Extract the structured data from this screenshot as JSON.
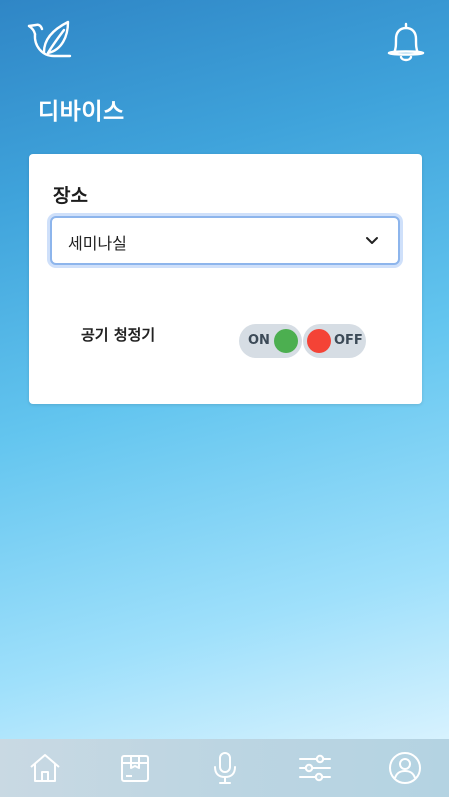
{
  "header": {
    "logo_icon": "dove-leaf-logo-icon",
    "notification_icon": "bell-icon"
  },
  "page": {
    "title": "디바이스"
  },
  "location": {
    "label": "장소",
    "selected": "세미나실"
  },
  "device": {
    "name": "공기 청정기",
    "on_label": "ON",
    "off_label": "OFF",
    "on_color": "#4caf50",
    "off_color": "#f44336"
  },
  "bottom_nav": [
    {
      "icon": "home-icon"
    },
    {
      "icon": "box-icon"
    },
    {
      "icon": "microphone-icon"
    },
    {
      "icon": "sliders-icon"
    },
    {
      "icon": "user-icon"
    }
  ],
  "colors": {
    "accent": "#8db5ec",
    "background_top": "#2f86c6",
    "background_bottom": "#eaf8ff"
  }
}
